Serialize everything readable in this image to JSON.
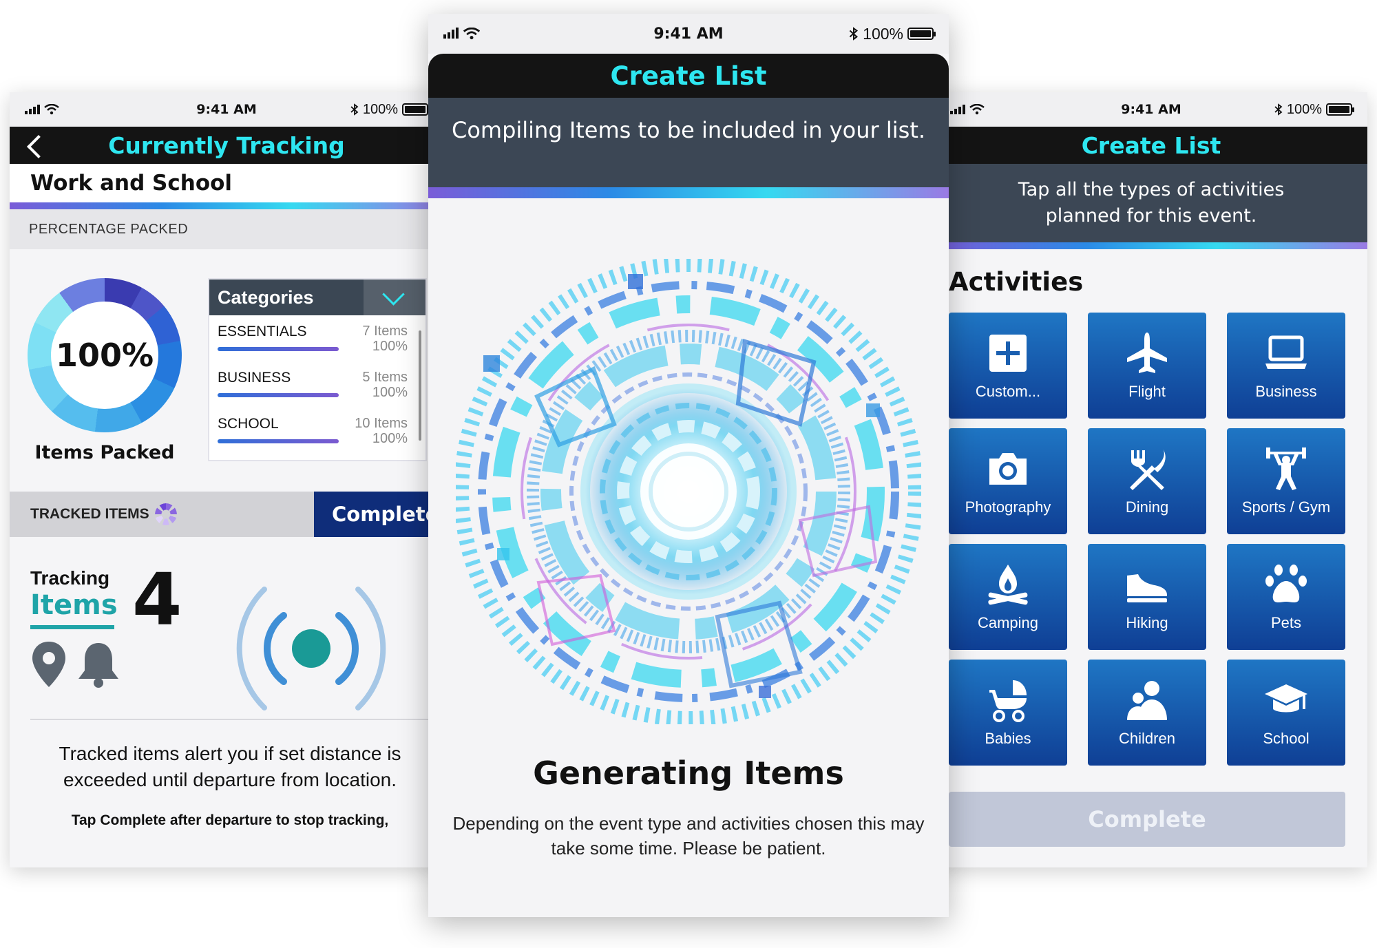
{
  "status_bar": {
    "time": "9:41 AM",
    "battery_percent": "100%"
  },
  "left_screen": {
    "header_title": "Currently Tracking",
    "event_name": "Work and School",
    "percentage_label": "PERCENTAGE PACKED",
    "donut": {
      "value": "100%",
      "caption": "Items Packed",
      "percent_packed": 100
    },
    "categories": {
      "title": "Categories",
      "items": [
        {
          "name": "ESSENTIALS",
          "count": "7 Items",
          "percent": "100%"
        },
        {
          "name": "BUSINESS",
          "count": "5 Items",
          "percent": "100%"
        },
        {
          "name": "SCHOOL",
          "count": "10 Items",
          "percent": "100%"
        }
      ]
    },
    "tracked_items_label": "TRACKED ITEMS",
    "complete_label": "Complete",
    "tracking": {
      "line1": "Tracking",
      "line2": "Items",
      "count": "4"
    },
    "note_main": "Tracked items alert you if set distance is exceeded until departure from location.",
    "note_sub": "Tap Complete after departure to stop tracking,"
  },
  "center_screen": {
    "header_title": "Create List",
    "subtitle": "Compiling Items to be included in your list.",
    "generating_title": "Generating Items",
    "generating_desc": "Depending on the event type and activities chosen this may take some time. Please be patient."
  },
  "right_screen": {
    "header_title": "Create List",
    "instruction": "Tap all the types of activities planned for this event.",
    "activities_title": "Activities",
    "tiles": [
      {
        "label": "Custom...",
        "icon": "plus-icon"
      },
      {
        "label": "Flight",
        "icon": "airplane-icon"
      },
      {
        "label": "Business",
        "icon": "laptop-icon"
      },
      {
        "label": "Photography",
        "icon": "camera-icon"
      },
      {
        "label": "Dining",
        "icon": "fork-knife-icon"
      },
      {
        "label": "Sports / Gym",
        "icon": "weightlifter-icon"
      },
      {
        "label": "Camping",
        "icon": "campfire-icon"
      },
      {
        "label": "Hiking",
        "icon": "shoe-icon"
      },
      {
        "label": "Pets",
        "icon": "paw-icon"
      },
      {
        "label": "Babies",
        "icon": "stroller-icon"
      },
      {
        "label": "Children",
        "icon": "children-icon"
      },
      {
        "label": "School",
        "icon": "graduation-cap-icon"
      }
    ],
    "complete_label": "Complete"
  },
  "colors": {
    "header_bg": "#141414",
    "header_text": "#2ee6f0",
    "tile_top": "#1f76c4",
    "tile_bottom": "#0f3f95",
    "complete_blue": "#0f2d7a",
    "teal": "#1fa4a8",
    "slate": "#3c4755"
  }
}
